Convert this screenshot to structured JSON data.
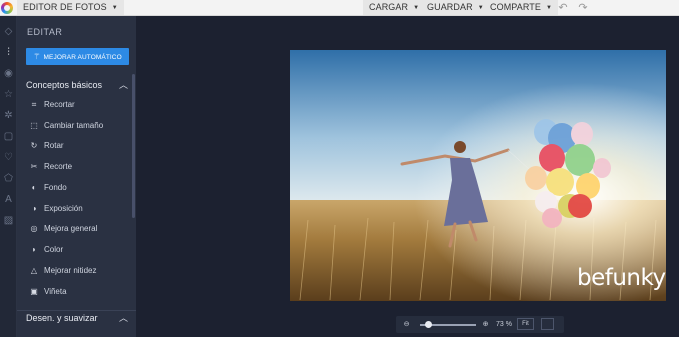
{
  "topbar": {
    "app_menu": "EDITOR DE FOTOS",
    "load": "CARGAR",
    "save": "GUARDAR",
    "share": "COMPARTE"
  },
  "rail_icons": [
    "layers-icon",
    "sliders-icon",
    "eye-icon",
    "star-icon",
    "gear-icon",
    "frame-icon",
    "heart-icon",
    "shape-icon",
    "text-icon",
    "texture-icon"
  ],
  "panel": {
    "title": "EDITAR",
    "auto_enhance": "MEJORAR AUTOMÁTICO",
    "sections": [
      {
        "label": "Conceptos básicos",
        "tools": [
          {
            "label": "Recortar",
            "icon": "crop-icon"
          },
          {
            "label": "Cambiar tamaño",
            "icon": "resize-icon"
          },
          {
            "label": "Rotar",
            "icon": "rotate-icon"
          },
          {
            "label": "Recorte",
            "icon": "cutout-icon"
          },
          {
            "label": "Fondo",
            "icon": "background-icon"
          },
          {
            "label": "Exposición",
            "icon": "exposure-icon"
          },
          {
            "label": "Mejora general",
            "icon": "enhance-icon"
          },
          {
            "label": "Color",
            "icon": "color-icon"
          },
          {
            "label": "Mejorar nitidez",
            "icon": "sharpen-icon"
          },
          {
            "label": "Viñeta",
            "icon": "vignette-icon"
          }
        ]
      },
      {
        "label": "Desen. y suavizar",
        "tools": []
      }
    ]
  },
  "canvas": {
    "watermark": "befunky",
    "zoom_percent": "73 %",
    "zoom_level": 0.15,
    "fit_label": "Fit"
  },
  "colors": {
    "accent": "#2d8ae5",
    "panel_bg": "#2a3142",
    "canvas_bg": "#1c2130"
  }
}
